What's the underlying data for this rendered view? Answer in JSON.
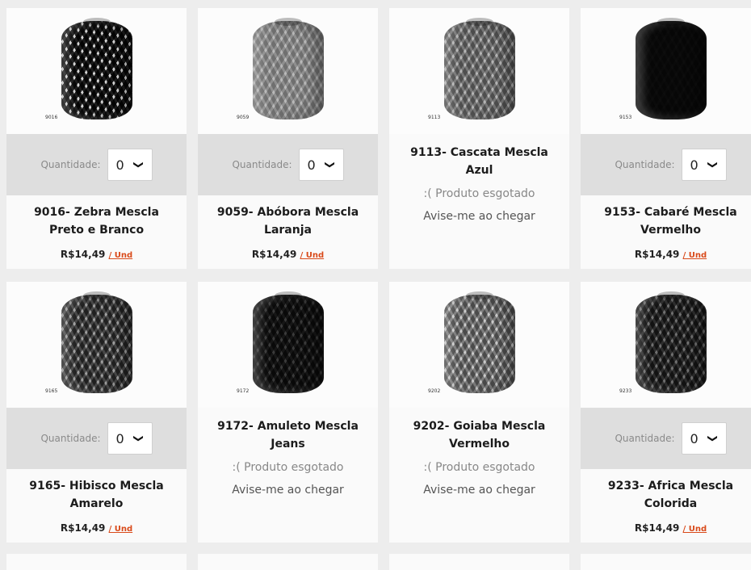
{
  "qty_label": "Quantidade:",
  "qty_value": "0",
  "products": [
    {
      "code": "9016",
      "name": "9016- Zebra Mescla Preto e Branco",
      "price": "R$14,49",
      "unit": "/ Und",
      "available": true,
      "tone": "#1e1e1e",
      "stripe": "#e7e7e7"
    },
    {
      "code": "9059",
      "name": "9059- Abóbora Mescla Laranja",
      "price": "R$14,49",
      "unit": "/ Und",
      "available": true,
      "tone": "#a8a8a8",
      "stripe": "#d9d9d9"
    },
    {
      "code": "9113",
      "name": "9113- Cascata Mescla Azul",
      "sold_out": ":( Produto esgotado",
      "notify": "Avise-me ao chegar",
      "available": false,
      "tone": "#8d8d8d",
      "stripe": "#d7d7d7"
    },
    {
      "code": "9153",
      "name": "9153- Cabaré Mescla Vermelho",
      "price": "R$14,49",
      "unit": "/ Und",
      "available": true,
      "tone": "#2a2a2a",
      "stripe": "#3a3a3a"
    },
    {
      "code": "9165",
      "name": "9165- Hibisco Mescla Amarelo",
      "price": "R$14,49",
      "unit": "/ Und",
      "available": true,
      "tone": "#5a5a5a",
      "stripe": "#c9c9c9"
    },
    {
      "code": "9172",
      "name": "9172- Amuleto Mescla Jeans",
      "sold_out": ":( Produto esgotado",
      "notify": "Avise-me ao chegar",
      "available": false,
      "tone": "#2f2f2f",
      "stripe": "#7a7a7a"
    },
    {
      "code": "9202",
      "name": "9202- Goiaba Mescla Vermelho",
      "sold_out": ":( Produto esgotado",
      "notify": "Avise-me ao chegar",
      "available": false,
      "tone": "#8a8a8a",
      "stripe": "#e3e3e3"
    },
    {
      "code": "9233",
      "name": "9233- Africa Mescla Colorida",
      "price": "R$14,49",
      "unit": "/ Und",
      "available": true,
      "tone": "#444444",
      "stripe": "#a9a9a9"
    }
  ]
}
